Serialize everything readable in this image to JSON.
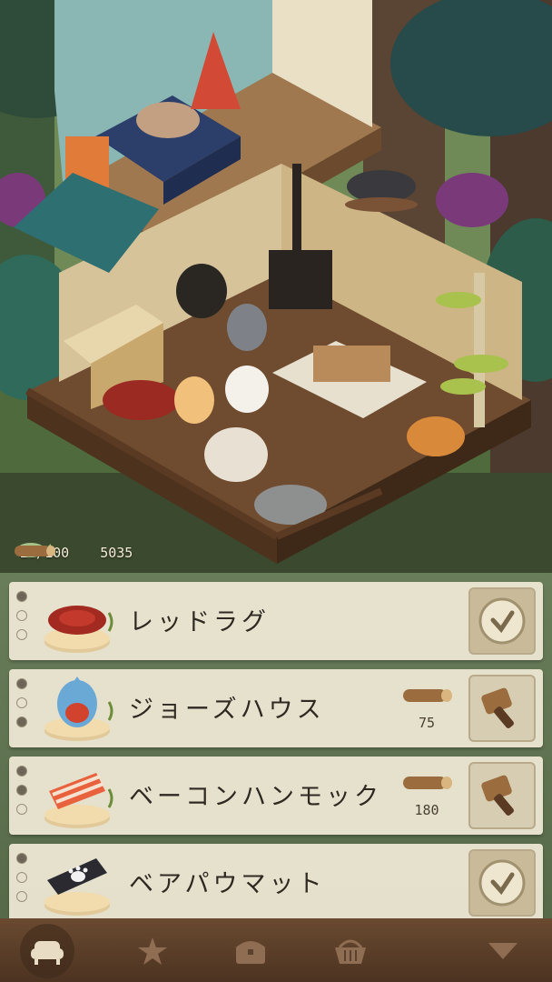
{
  "hud": {
    "fish_count": "20/100",
    "wood_count": "5035"
  },
  "items": [
    {
      "name": "レッドラグ",
      "status": "owned",
      "price": ""
    },
    {
      "name": "ジョーズハウス",
      "status": "buy",
      "price": "75"
    },
    {
      "name": "ベーコンハンモック",
      "status": "buy",
      "price": "180"
    },
    {
      "name": "ベアパウマット",
      "status": "owned",
      "price": ""
    }
  ],
  "tabs": [
    "sofa-icon",
    "star-icon",
    "chest-icon",
    "basket-icon",
    "arrow-down-icon"
  ],
  "colors": {
    "row_bg": "#f0ead6",
    "bottom_bar": "#5a3d28",
    "wood": "#7a5236"
  }
}
